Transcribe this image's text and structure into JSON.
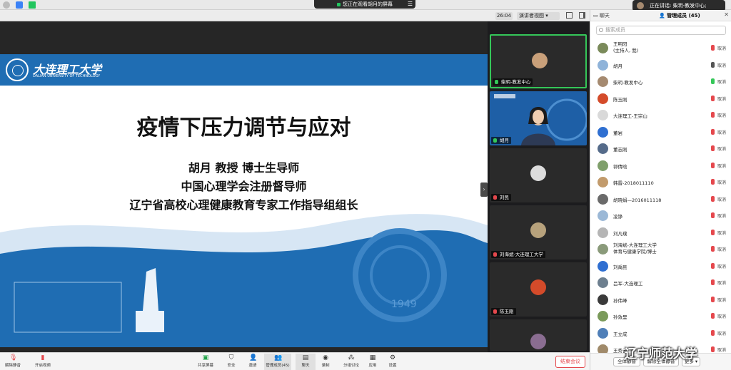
{
  "window": {
    "share_banner": "您正在观看胡月的屏幕",
    "speaking": "正在讲话: 柴玥-教发中心;"
  },
  "controls": {
    "timer": "26:04",
    "view_label": "演讲者视图 ▾"
  },
  "slide": {
    "logo_cn": "大连理工大学",
    "logo_en": "DALIAN UNIVERSITY OF TECHNOLOGY",
    "title": "疫情下压力调节与应对",
    "line1": "胡月  教授  博士生导师",
    "line2": "中国心理学会注册督导师",
    "line3": "辽宁省高校心理健康教育专家工作指导组组长",
    "bg_year": "1949"
  },
  "video_tiles": [
    {
      "name": "柴玥-教发中心"
    },
    {
      "name": "胡月"
    },
    {
      "name": "刘民"
    },
    {
      "name": "刘海斌-大连理工大学"
    },
    {
      "name": "陈玉刚"
    }
  ],
  "panel": {
    "tab_chat": "聊天",
    "tab_members": "管理成员 (45)",
    "search_placeholder": "搜索成员",
    "participants": [
      {
        "name": "王明阳",
        "sub": "(主持人, 我)",
        "tag": "取消"
      },
      {
        "name": "胡月",
        "tag": "取消"
      },
      {
        "name": "柴玥-教发中心",
        "tag": "取消"
      },
      {
        "name": "陈玉刚",
        "tag": "取消"
      },
      {
        "name": "大连理工-王宗山",
        "tag": "取消"
      },
      {
        "name": "董岩",
        "tag": "取消"
      },
      {
        "name": "董志刚",
        "tag": "取消"
      },
      {
        "name": "郭倩晗",
        "tag": "取消"
      },
      {
        "name": "韩雷-2018011110",
        "tag": "取消"
      },
      {
        "name": "胡晓娟—2016011118",
        "tag": "取消"
      },
      {
        "name": "凌铮",
        "tag": "取消"
      },
      {
        "name": "刘凡璞",
        "tag": "取消"
      },
      {
        "name": "刘海斌-大连理工大学",
        "sub": "体育与健康学院/博士",
        "tag": "取消"
      },
      {
        "name": "刘禹民",
        "tag": "取消"
      },
      {
        "name": "吕军-大连理工",
        "tag": "取消"
      },
      {
        "name": "孙伟峰",
        "tag": "取消"
      },
      {
        "name": "孙效里",
        "tag": "取消"
      },
      {
        "name": "王立成",
        "tag": "取消"
      },
      {
        "name": "王秀云",
        "tag": "取消"
      }
    ],
    "mute_all": "全体静音",
    "unmute_all": "解除全体静音",
    "more": "更多 ▾"
  },
  "toolbar": {
    "mute": "解除静音",
    "video": "开启视频",
    "share": "共享屏幕",
    "security": "安全",
    "invite": "邀请",
    "members": "管理成员(45)",
    "chat": "聊天",
    "record": "录制",
    "breakout": "分组讨论",
    "apps": "应用",
    "settings": "设置",
    "end": "结束会议"
  },
  "watermark": "辽宁师范大学",
  "colors": {
    "brand_blue": "#1f6db3",
    "active_green": "#35c759",
    "end_red": "#e5484d"
  }
}
